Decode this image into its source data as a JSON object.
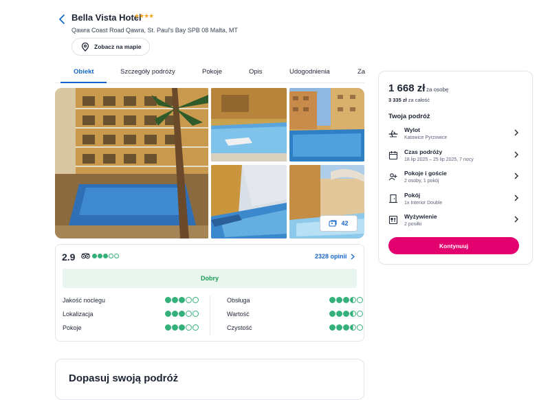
{
  "header": {
    "hotel_name": "Bella Vista Hotel",
    "stars": "★★★★",
    "address": "Qawra Coast Road Qawra, St. Paul's Bay SPB 08 Malta, MT",
    "map_button": "Zobacz na mapie"
  },
  "tabs": [
    {
      "label": "Obiekt",
      "active": true
    },
    {
      "label": "Szczegóły podróży"
    },
    {
      "label": "Pokoje"
    },
    {
      "label": "Opis"
    },
    {
      "label": "Udogodnienia"
    },
    {
      "label": "Za"
    }
  ],
  "gallery": {
    "photo_count": "42"
  },
  "rating": {
    "score": "2.9",
    "circles": 3,
    "opinions": "2328 opinii",
    "verdict": "Dobry",
    "left": [
      {
        "label": "Jakość noclegu",
        "value": 3
      },
      {
        "label": "Lokalizacja",
        "value": 3
      },
      {
        "label": "Pokoje",
        "value": 3
      }
    ],
    "right": [
      {
        "label": "Obsługa",
        "value": 3.5
      },
      {
        "label": "Wartość",
        "value": 3.5
      },
      {
        "label": "Czystość",
        "value": 3.5
      }
    ]
  },
  "bottom_card": {
    "title": "Dopasuj swoją podróż"
  },
  "booking": {
    "price": "1 668 zł",
    "price_per": "za osobę",
    "total_amount": "3 335 zł",
    "total_label": "za całość",
    "trip_title": "Twoja podróż",
    "rows": [
      {
        "title": "Wylot",
        "value": "Katowice Pyrzowice",
        "icon": "plane-icon"
      },
      {
        "title": "Czas podróży",
        "value": "18 lip 2025 – 25 lip 2025, 7 nocy",
        "icon": "calendar-icon"
      },
      {
        "title": "Pokoje i goście",
        "value": "2 osoby, 1 pokój",
        "icon": "guests-icon"
      },
      {
        "title": "Pokój",
        "value": "1x Interior Double",
        "icon": "door-icon"
      },
      {
        "title": "Wyżywienie",
        "value": "2 posiłki",
        "icon": "meal-icon"
      }
    ],
    "cta": "Kontynuuj"
  },
  "colors": {
    "accent": "#1566c8",
    "cta": "#e3006f",
    "rating_green": "#34b07a",
    "verdict_bg": "#e8f6ef"
  }
}
